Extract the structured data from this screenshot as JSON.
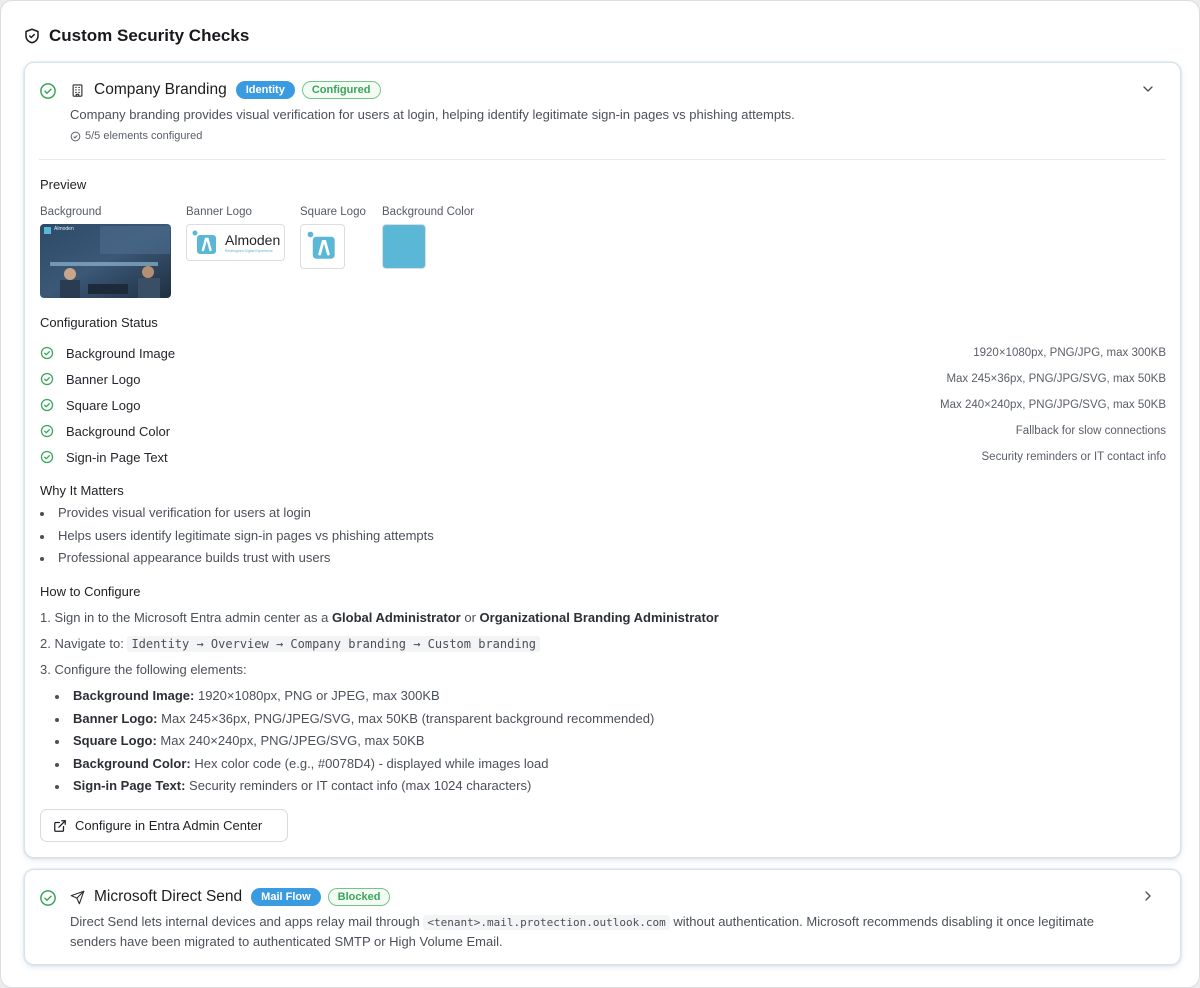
{
  "section": {
    "title": "Custom Security Checks",
    "icon": "shield-check-icon"
  },
  "card1": {
    "title": "Company Branding",
    "icon": "building-icon",
    "badge_category": "Identity",
    "badge_status": "Configured",
    "description": "Company branding provides visual verification for users at login, helping identify legitimate sign-in pages vs phishing attempts.",
    "elements_configured": "5/5 elements configured",
    "preview": {
      "heading": "Preview",
      "background_label": "Background",
      "background_thumb_brand": "Almoden",
      "banner_label": "Banner Logo",
      "banner_text": "Almoden",
      "banner_tagline": "Redesigned Digital Experience",
      "square_label": "Square Logo",
      "color_label": "Background Color",
      "color_value": "#5bb7d6"
    },
    "config_status": {
      "heading": "Configuration Status",
      "items": [
        {
          "name": "Background Image",
          "detail": "1920×1080px, PNG/JPG, max 300KB"
        },
        {
          "name": "Banner Logo",
          "detail": "Max 245×36px, PNG/JPG/SVG, max 50KB"
        },
        {
          "name": "Square Logo",
          "detail": "Max 240×240px, PNG/JPG/SVG, max 50KB"
        },
        {
          "name": "Background Color",
          "detail": "Fallback for slow connections"
        },
        {
          "name": "Sign-in Page Text",
          "detail": "Security reminders or IT contact info"
        }
      ]
    },
    "why": {
      "heading": "Why It Matters",
      "items": [
        "Provides visual verification for users at login",
        "Helps users identify legitimate sign-in pages vs phishing attempts",
        "Professional appearance builds trust with users"
      ]
    },
    "how": {
      "heading": "How to Configure",
      "step1_prefix": "1. Sign in to the Microsoft Entra admin center as a ",
      "step1_role1": "Global Administrator",
      "step1_or": " or ",
      "step1_role2": "Organizational Branding Administrator",
      "step2_prefix": "2. Navigate to: ",
      "step2_path": "Identity → Overview → Company branding → Custom branding",
      "step3": "3. Configure the following elements:",
      "elements": [
        {
          "label": "Background Image:",
          "text": " 1920×1080px, PNG or JPEG, max 300KB"
        },
        {
          "label": "Banner Logo:",
          "text": " Max 245×36px, PNG/JPEG/SVG, max 50KB (transparent background recommended)"
        },
        {
          "label": "Square Logo:",
          "text": " Max 240×240px, PNG/JPEG/SVG, max 50KB"
        },
        {
          "label": "Background Color:",
          "text": " Hex color code (e.g., #0078D4) - displayed while images load"
        },
        {
          "label": "Sign-in Page Text:",
          "text": " Security reminders or IT contact info (max 1024 characters)"
        }
      ]
    },
    "button": "Configure in Entra Admin Center"
  },
  "card2": {
    "title": "Microsoft Direct Send",
    "icon": "send-icon",
    "badge_category": "Mail Flow",
    "badge_status": "Blocked",
    "desc_before": "Direct Send lets internal devices and apps relay mail through ",
    "desc_code": "<tenant>.mail.protection.outlook.com",
    "desc_after": " without authentication. Microsoft recommends disabling it once legitimate senders have been migrated to authenticated SMTP or High Volume Email."
  },
  "colors": {
    "accent": "#3b9be0",
    "success": "#3aa65a",
    "swatch": "#5bb7d6"
  }
}
